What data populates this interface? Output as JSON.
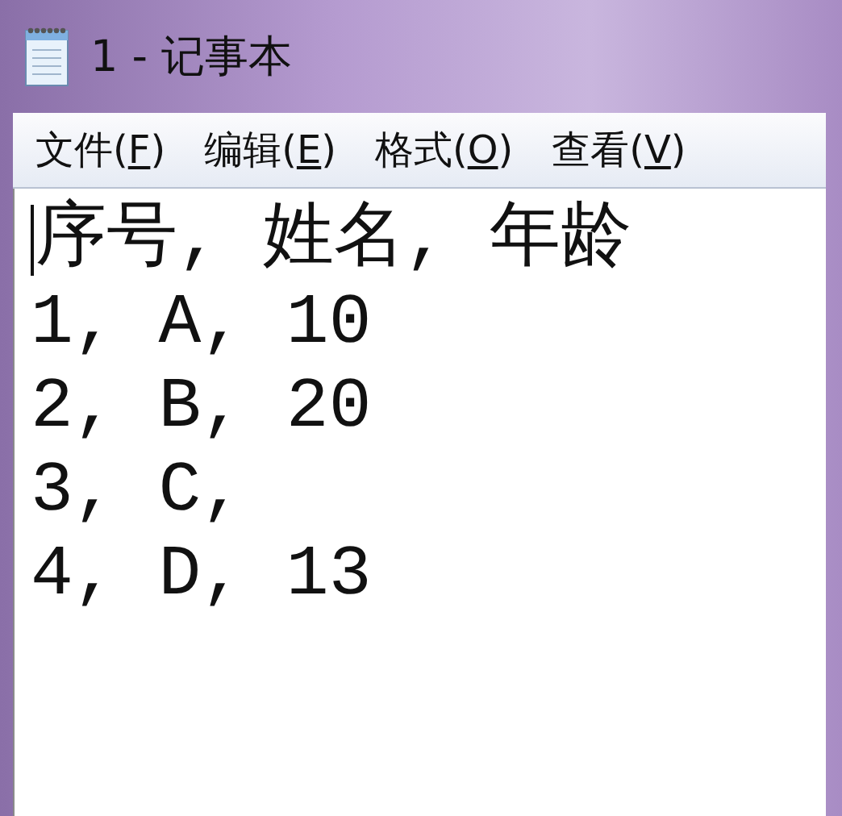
{
  "window": {
    "title": "1 - 记事本"
  },
  "menu": [
    {
      "label": "文件(",
      "access_key": "F",
      "end": ")"
    },
    {
      "label": "编辑(",
      "access_key": "E",
      "end": ")"
    },
    {
      "label": "格式(",
      "access_key": "O",
      "end": ")"
    },
    {
      "label": "查看(",
      "access_key": "V",
      "end": ")"
    }
  ],
  "editor": {
    "lines": [
      "序号, 姓名, 年龄",
      "1, A, 10",
      "2, B, 20",
      "3, C,",
      "4, D, 13"
    ],
    "caret": true
  }
}
